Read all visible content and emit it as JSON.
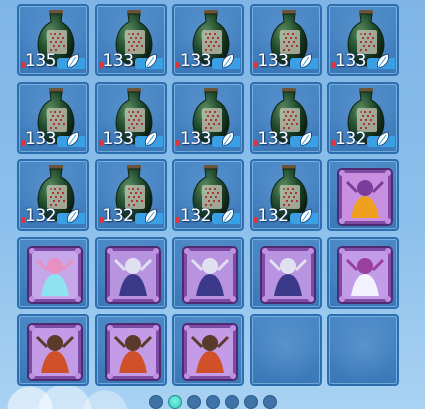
{
  "inventory": {
    "slots": [
      {
        "kind": "jar",
        "count": "135"
      },
      {
        "kind": "jar",
        "count": "133"
      },
      {
        "kind": "jar",
        "count": "133"
      },
      {
        "kind": "jar",
        "count": "133"
      },
      {
        "kind": "jar",
        "count": "133"
      },
      {
        "kind": "jar",
        "count": "133"
      },
      {
        "kind": "jar",
        "count": "133"
      },
      {
        "kind": "jar",
        "count": "133"
      },
      {
        "kind": "jar",
        "count": "133"
      },
      {
        "kind": "jar",
        "count": "132"
      },
      {
        "kind": "jar",
        "count": "132"
      },
      {
        "kind": "jar",
        "count": "132"
      },
      {
        "kind": "jar",
        "count": "132"
      },
      {
        "kind": "jar",
        "count": "132"
      },
      {
        "kind": "card",
        "variant": "beast"
      },
      {
        "kind": "card",
        "variant": "fairy"
      },
      {
        "kind": "card",
        "variant": "dark-knight"
      },
      {
        "kind": "card",
        "variant": "dark-knight"
      },
      {
        "kind": "card",
        "variant": "dark-knight"
      },
      {
        "kind": "card",
        "variant": "mage"
      },
      {
        "kind": "card",
        "variant": "warrior"
      },
      {
        "kind": "card",
        "variant": "warrior"
      },
      {
        "kind": "card",
        "variant": "warrior"
      },
      {
        "kind": "empty"
      },
      {
        "kind": "empty"
      }
    ]
  },
  "pager": {
    "pages": 7,
    "active": 1
  },
  "colors": {
    "slot_border": "#2d6fae",
    "counter_strip": "#3aa0e6",
    "active_dot": "#2fc7b8"
  }
}
